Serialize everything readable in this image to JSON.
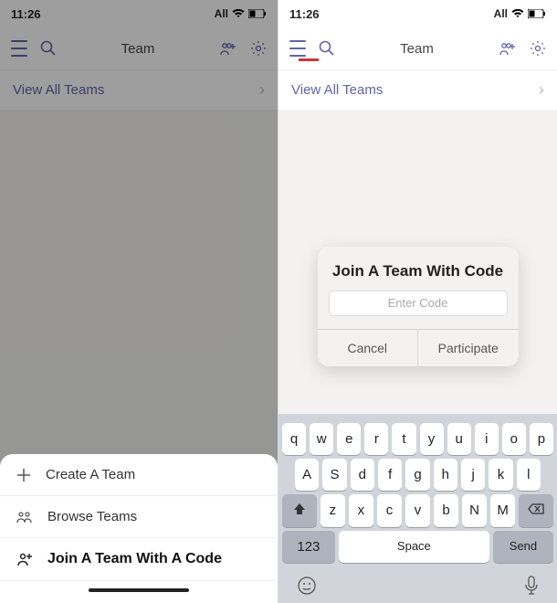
{
  "left": {
    "statusbar": {
      "time": "11:26",
      "carrier": "All"
    },
    "topbar": {
      "title": "Team"
    },
    "viewall": {
      "label": "View All Teams"
    },
    "sheet": {
      "create": "Create A Team",
      "browse": "Browse Teams",
      "join": "Join A Team With A Code"
    }
  },
  "right": {
    "statusbar": {
      "time": "11:26",
      "carrier": "All"
    },
    "topbar": {
      "title": "Team"
    },
    "viewall": {
      "label": "View All Teams"
    },
    "dialog": {
      "title": "Join A Team With Code",
      "placeholder": "Enter Code",
      "cancel": "Cancel",
      "participate": "Participate"
    },
    "keyboard": {
      "row1": [
        "q",
        "w",
        "e",
        "r",
        "t",
        "y",
        "u",
        "i",
        "o",
        "p"
      ],
      "row2": [
        "A",
        "S",
        "d",
        "f",
        "g",
        "h",
        "j",
        "k",
        "l"
      ],
      "row3": [
        "z",
        "x",
        "c",
        "v",
        "b",
        "N",
        "M"
      ],
      "numeric": "123",
      "space": "Space",
      "send": "Send"
    }
  }
}
